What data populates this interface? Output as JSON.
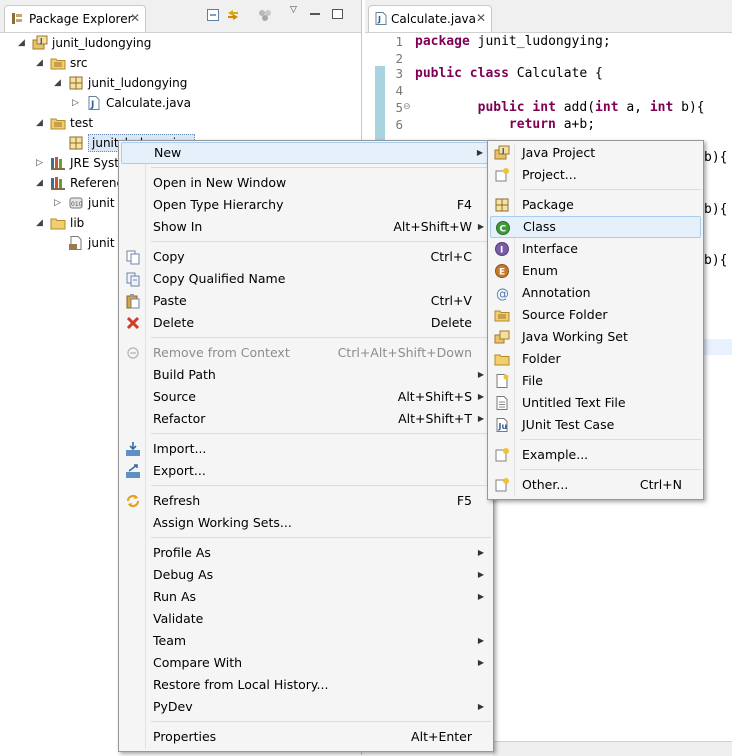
{
  "package_explorer": {
    "title": "Package Explorer",
    "tree": [
      {
        "label": "junit_ludongying",
        "icon": "java-project-icon",
        "indent": 0,
        "twisty": "open"
      },
      {
        "label": "src",
        "icon": "source-folder-icon",
        "indent": 1,
        "twisty": "open"
      },
      {
        "label": "junit_ludongying",
        "icon": "package-icon",
        "indent": 2,
        "twisty": "open"
      },
      {
        "label": "Calculate.java",
        "icon": "java-file-icon",
        "indent": 3,
        "twisty": "closed"
      },
      {
        "label": "test",
        "icon": "source-folder-icon",
        "indent": 1,
        "twisty": "open"
      },
      {
        "label": "junit_ludongying",
        "icon": "package-icon",
        "indent": 2,
        "twisty": "none",
        "selected": true
      },
      {
        "label": "JRE System Library",
        "icon": "library-icon",
        "indent": 1,
        "twisty": "closed"
      },
      {
        "label": "Referenced Libraries",
        "icon": "library-icon",
        "indent": 1,
        "twisty": "open"
      },
      {
        "label": "junit",
        "icon": "jar-icon",
        "indent": 2,
        "twisty": "closed"
      },
      {
        "label": "lib",
        "icon": "folder-icon",
        "indent": 1,
        "twisty": "open"
      },
      {
        "label": "junit",
        "icon": "jar-file-icon",
        "indent": 2,
        "twisty": "none"
      }
    ]
  },
  "editor": {
    "tab_label": "Calculate.java",
    "lines": [
      {
        "num": "1",
        "parts": [
          {
            "t": "package",
            "kw": true
          },
          {
            "t": " junit_ludongying;"
          }
        ]
      },
      {
        "num": "2",
        "parts": []
      },
      {
        "num": "3",
        "parts": [
          {
            "t": "public",
            "kw": true
          },
          {
            "t": " "
          },
          {
            "t": "class",
            "kw": true
          },
          {
            "t": " Calculate {"
          }
        ]
      },
      {
        "num": "4",
        "parts": []
      },
      {
        "num": "5",
        "parts": [
          {
            "t": "        "
          },
          {
            "t": "public",
            "kw": true
          },
          {
            "t": " "
          },
          {
            "t": "int",
            "kw": true
          },
          {
            "t": " add("
          },
          {
            "t": "int",
            "kw": true
          },
          {
            "t": " a, "
          },
          {
            "t": "int",
            "kw": true
          },
          {
            "t": " b){"
          }
        ]
      },
      {
        "num": "6",
        "parts": [
          {
            "t": "            "
          },
          {
            "t": "return",
            "kw": true
          },
          {
            "t": " a+b;"
          }
        ]
      }
    ],
    "fragments": [
      "b){",
      "b){",
      "b){"
    ]
  },
  "context_menu": {
    "groups": [
      [
        {
          "label": "New",
          "submenu": true,
          "highlighted": true
        }
      ],
      [
        {
          "label": "Open in New Window"
        },
        {
          "label": "Open Type Hierarchy",
          "accel": "F4"
        },
        {
          "label": "Show In",
          "accel": "Alt+Shift+W",
          "submenu": true
        }
      ],
      [
        {
          "label": "Copy",
          "accel": "Ctrl+C",
          "icon": "copy-icon"
        },
        {
          "label": "Copy Qualified Name",
          "icon": "copy-qualified-icon"
        },
        {
          "label": "Paste",
          "accel": "Ctrl+V",
          "icon": "paste-icon"
        },
        {
          "label": "Delete",
          "accel": "Delete",
          "icon": "delete-icon"
        }
      ],
      [
        {
          "label": "Remove from Context",
          "accel": "Ctrl+Alt+Shift+Down",
          "disabled": true,
          "icon": "remove-context-icon"
        },
        {
          "label": "Build Path",
          "submenu": true
        },
        {
          "label": "Source",
          "accel": "Alt+Shift+S",
          "submenu": true
        },
        {
          "label": "Refactor",
          "accel": "Alt+Shift+T",
          "submenu": true
        }
      ],
      [
        {
          "label": "Import...",
          "icon": "import-icon"
        },
        {
          "label": "Export...",
          "icon": "export-icon"
        }
      ],
      [
        {
          "label": "Refresh",
          "accel": "F5",
          "icon": "refresh-icon"
        },
        {
          "label": "Assign Working Sets..."
        }
      ],
      [
        {
          "label": "Profile As",
          "submenu": true
        },
        {
          "label": "Debug As",
          "submenu": true
        },
        {
          "label": "Run As",
          "submenu": true
        },
        {
          "label": "Validate"
        },
        {
          "label": "Team",
          "submenu": true
        },
        {
          "label": "Compare With",
          "submenu": true
        },
        {
          "label": "Restore from Local History..."
        },
        {
          "label": "PyDev",
          "submenu": true
        }
      ],
      [
        {
          "label": "Properties",
          "accel": "Alt+Enter"
        }
      ]
    ]
  },
  "submenu": {
    "groups": [
      [
        {
          "label": "Java Project",
          "icon": "java-project-icon"
        },
        {
          "label": "Project...",
          "icon": "project-icon"
        }
      ],
      [
        {
          "label": "Package",
          "icon": "package-icon"
        },
        {
          "label": "Class",
          "icon": "class-icon",
          "highlighted": true
        },
        {
          "label": "Interface",
          "icon": "interface-icon"
        },
        {
          "label": "Enum",
          "icon": "enum-icon"
        },
        {
          "label": "Annotation",
          "icon": "annotation-icon"
        },
        {
          "label": "Source Folder",
          "icon": "source-folder-icon"
        },
        {
          "label": "Java Working Set",
          "icon": "working-set-icon"
        },
        {
          "label": "Folder",
          "icon": "folder-icon"
        },
        {
          "label": "File",
          "icon": "file-icon"
        },
        {
          "label": "Untitled Text File",
          "icon": "text-file-icon"
        },
        {
          "label": "JUnit Test Case",
          "icon": "junit-icon"
        }
      ],
      [
        {
          "label": "Example...",
          "icon": "example-icon"
        }
      ],
      [
        {
          "label": "Other...",
          "accel": "Ctrl+N",
          "icon": "other-icon"
        }
      ]
    ]
  }
}
